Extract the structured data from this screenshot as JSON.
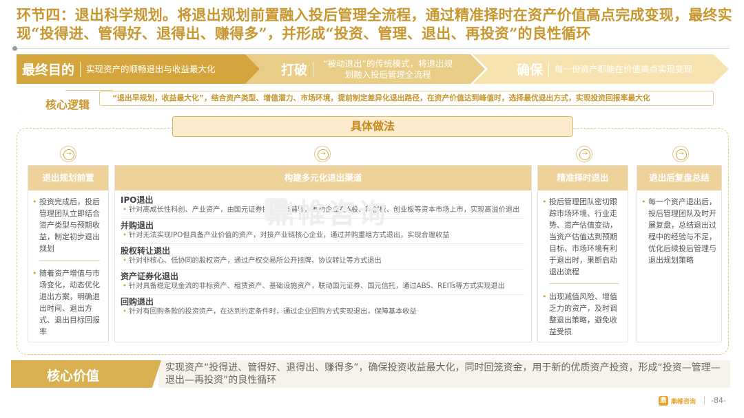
{
  "title": "环节四：退出科学规划。将退出规划前置融入投后管理全流程，通过精准择时在资产价值高点完成变现，最终实现“投得进、管得好、退得出、赚得多”，并形成“投资、管理、退出、再投资”的良性循环",
  "banner": [
    {
      "head": "最终目的",
      "text": "实现资产的顺畅退出与收益最大化"
    },
    {
      "head": "打破",
      "text": "“被动退出”的传统模式，将退出规划融入投后管理全流程"
    },
    {
      "head": "确保",
      "text": "每一份资产都能在价值高点实现变现"
    }
  ],
  "core_logic": {
    "label": "核心逻辑",
    "text": "“退出早规划，收益最大化”，结合资产类型、增值潜力、市场环境，提前制定差异化退出路径，在资产价值达到峰值时，选择最优退出方式，实现投资回报率最大化"
  },
  "approach_title": "具体做法",
  "columns": {
    "planning": {
      "head": "退出规划前置",
      "bullets": [
        "投资完成后，投后管理团队立即结合资产类型与预期收益，制定初步退出规划",
        "随着资产增值与市场变化，动态优化退出方案，明确退出时间、退出方式、退出目标回报率"
      ]
    },
    "channels": {
      "head": "构建多元化退出渠道",
      "items": [
        {
          "name": "IPO退出",
          "desc": "针对高成长性科创、产业资产，由国元证券提供上市辅导，推动企业在A股、科创板、创业板等资本市场上市，实现高溢价退出"
        },
        {
          "name": "并购退出",
          "desc": "针对无法实现IPO但具备产业价值的资产，对接产业链核心企业，通过并购重组方式退出，实现合理收益"
        },
        {
          "name": "股权转让退出",
          "desc": "针对非核心、低协同的股权资产，通过产权交易所公开挂牌、协议转让等方式退出"
        },
        {
          "name": "资产证券化退出",
          "desc": "针对具备稳定现金流的非标资产、租赁资产、基础设施资产，联动国元证券、国元信托，通过ABS、REITs等方式实现退出"
        },
        {
          "name": "回购退出",
          "desc": "针对有回购条款的投资资产，在达到约定条件时，通过企业回购方式实现退出，保障基本收益"
        }
      ]
    },
    "timing": {
      "head": "精准择时退出",
      "bullets": [
        "投后管理团队密切跟踪市场环境、行业走势、资产估值变动，当资产估值达到预期目标、市场环境有利于退出时，果断启动退出流程",
        "出现减值风险、增值乏力的资产，及时调整退出策略，避免收益受损"
      ]
    },
    "review": {
      "head": "退出后复盘总结",
      "bullets": [
        "每一个资产退出后，投后管理团队及时开展复盘，总结退出过程中的经验与不足，优化后续投后管理与退出规划策略"
      ]
    }
  },
  "watermark": "鼎帷咨询",
  "core_value": {
    "label": "核心价值",
    "text": "实现资产“投得进、管得好、退得出、赚得多”，确保投资收益最大化，同时回笼资金，用于新的优质资产投资，形成“投资—管理—退出—再投资”的良性循环"
  },
  "footer": {
    "logo_glyph": "鼎",
    "brand": "鼎帷咨询",
    "page": "-84-"
  },
  "colors": {
    "gold": "#d4a53c",
    "gold_light": "#efd29a",
    "title": "#c8962e"
  }
}
